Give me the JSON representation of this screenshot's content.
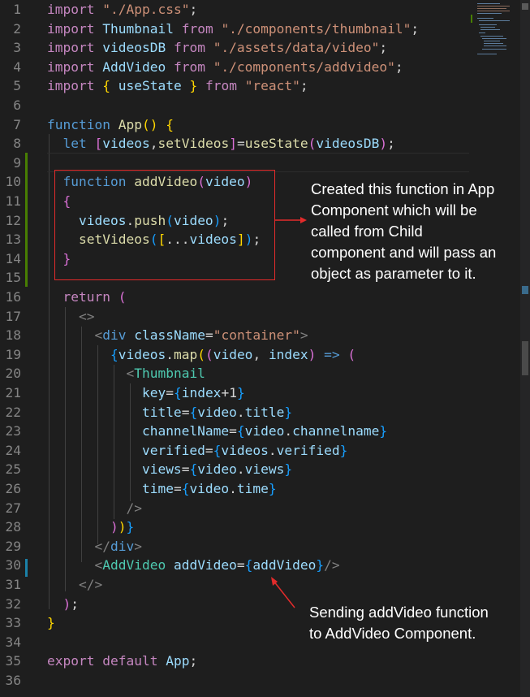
{
  "editor": {
    "lines": [
      {
        "n": "1",
        "tokens": [
          [
            "kw",
            "import"
          ],
          [
            "t",
            " "
          ],
          [
            "str",
            "\"./App.css\""
          ],
          [
            "t",
            ";"
          ]
        ]
      },
      {
        "n": "2",
        "tokens": [
          [
            "kw",
            "import"
          ],
          [
            "t",
            " "
          ],
          [
            "var",
            "Thumbnail"
          ],
          [
            "t",
            " "
          ],
          [
            "kw",
            "from"
          ],
          [
            "t",
            " "
          ],
          [
            "str",
            "\"./components/thumbnail\""
          ],
          [
            "t",
            ";"
          ]
        ]
      },
      {
        "n": "3",
        "tokens": [
          [
            "kw",
            "import"
          ],
          [
            "t",
            " "
          ],
          [
            "var",
            "videosDB"
          ],
          [
            "t",
            " "
          ],
          [
            "kw",
            "from"
          ],
          [
            "t",
            " "
          ],
          [
            "str",
            "\"./assets/data/video\""
          ],
          [
            "t",
            ";"
          ]
        ]
      },
      {
        "n": "4",
        "tokens": [
          [
            "kw",
            "import"
          ],
          [
            "t",
            " "
          ],
          [
            "var",
            "AddVideo"
          ],
          [
            "t",
            " "
          ],
          [
            "kw",
            "from"
          ],
          [
            "t",
            " "
          ],
          [
            "str",
            "\"./components/addvideo\""
          ],
          [
            "t",
            ";"
          ]
        ]
      },
      {
        "n": "5",
        "tokens": [
          [
            "kw",
            "import"
          ],
          [
            "t",
            " "
          ],
          [
            "b1",
            "{"
          ],
          [
            "t",
            " "
          ],
          [
            "var",
            "useState"
          ],
          [
            "t",
            " "
          ],
          [
            "b1",
            "}"
          ],
          [
            "t",
            " "
          ],
          [
            "kw",
            "from"
          ],
          [
            "t",
            " "
          ],
          [
            "str",
            "\"react\""
          ],
          [
            "t",
            ";"
          ]
        ]
      },
      {
        "n": "6",
        "tokens": []
      },
      {
        "n": "7",
        "tokens": [
          [
            "dkw",
            "function"
          ],
          [
            "t",
            " "
          ],
          [
            "fn",
            "App"
          ],
          [
            "b1",
            "()"
          ],
          [
            "t",
            " "
          ],
          [
            "b1",
            "{"
          ]
        ]
      },
      {
        "n": "8",
        "tokens": [
          [
            "t",
            "  "
          ],
          [
            "dkw",
            "let"
          ],
          [
            "t",
            " "
          ],
          [
            "b2",
            "["
          ],
          [
            "var",
            "videos"
          ],
          [
            "t",
            ","
          ],
          [
            "fn",
            "setVideos"
          ],
          [
            "b2",
            "]"
          ],
          [
            "t",
            "="
          ],
          [
            "fn",
            "useState"
          ],
          [
            "b2",
            "("
          ],
          [
            "var",
            "videosDB"
          ],
          [
            "b2",
            ")"
          ],
          [
            "t",
            ";"
          ]
        ]
      },
      {
        "n": "9",
        "tokens": []
      },
      {
        "n": "10",
        "tokens": [
          [
            "t",
            "  "
          ],
          [
            "dkw",
            "function"
          ],
          [
            "t",
            " "
          ],
          [
            "fn",
            "addVideo"
          ],
          [
            "b2",
            "("
          ],
          [
            "var",
            "video"
          ],
          [
            "b2",
            ")"
          ]
        ]
      },
      {
        "n": "11",
        "tokens": [
          [
            "t",
            "  "
          ],
          [
            "b2",
            "{"
          ]
        ]
      },
      {
        "n": "12",
        "tokens": [
          [
            "t",
            "    "
          ],
          [
            "var",
            "videos"
          ],
          [
            "t",
            "."
          ],
          [
            "fn",
            "push"
          ],
          [
            "b3",
            "("
          ],
          [
            "var",
            "video"
          ],
          [
            "b3",
            ")"
          ],
          [
            "t",
            ";"
          ]
        ]
      },
      {
        "n": "13",
        "tokens": [
          [
            "t",
            "    "
          ],
          [
            "fn",
            "setVideos"
          ],
          [
            "b3",
            "("
          ],
          [
            "b1",
            "["
          ],
          [
            "t",
            "..."
          ],
          [
            "var",
            "videos"
          ],
          [
            "b1",
            "]"
          ],
          [
            "b3",
            ")"
          ],
          [
            "t",
            ";"
          ]
        ]
      },
      {
        "n": "14",
        "tokens": [
          [
            "t",
            "  "
          ],
          [
            "b2",
            "}"
          ]
        ]
      },
      {
        "n": "15",
        "tokens": []
      },
      {
        "n": "16",
        "tokens": [
          [
            "t",
            "  "
          ],
          [
            "kw",
            "return"
          ],
          [
            "t",
            " "
          ],
          [
            "b2",
            "("
          ]
        ]
      },
      {
        "n": "17",
        "tokens": [
          [
            "t",
            "    "
          ],
          [
            "pun",
            "<>"
          ]
        ]
      },
      {
        "n": "18",
        "tokens": [
          [
            "t",
            "      "
          ],
          [
            "pun",
            "<"
          ],
          [
            "tag",
            "div"
          ],
          [
            "t",
            " "
          ],
          [
            "attr",
            "className"
          ],
          [
            "t",
            "="
          ],
          [
            "str",
            "\"container\""
          ],
          [
            "pun",
            ">"
          ]
        ]
      },
      {
        "n": "19",
        "tokens": [
          [
            "t",
            "        "
          ],
          [
            "b3",
            "{"
          ],
          [
            "var",
            "videos"
          ],
          [
            "t",
            "."
          ],
          [
            "fn",
            "map"
          ],
          [
            "b1",
            "("
          ],
          [
            "b2",
            "("
          ],
          [
            "var",
            "video"
          ],
          [
            "t",
            ", "
          ],
          [
            "var",
            "index"
          ],
          [
            "b2",
            ")"
          ],
          [
            "t",
            " "
          ],
          [
            "dkw",
            "=>"
          ],
          [
            "t",
            " "
          ],
          [
            "b2",
            "("
          ]
        ]
      },
      {
        "n": "20",
        "tokens": [
          [
            "t",
            "          "
          ],
          [
            "pun",
            "<"
          ],
          [
            "comp",
            "Thumbnail"
          ]
        ]
      },
      {
        "n": "21",
        "tokens": [
          [
            "t",
            "            "
          ],
          [
            "attr",
            "key"
          ],
          [
            "t",
            "="
          ],
          [
            "b3",
            "{"
          ],
          [
            "var",
            "index"
          ],
          [
            "t",
            "+"
          ],
          [
            "t",
            "1"
          ],
          [
            "b3",
            "}"
          ]
        ]
      },
      {
        "n": "22",
        "tokens": [
          [
            "t",
            "            "
          ],
          [
            "attr",
            "title"
          ],
          [
            "t",
            "="
          ],
          [
            "b3",
            "{"
          ],
          [
            "var",
            "video"
          ],
          [
            "t",
            "."
          ],
          [
            "var",
            "title"
          ],
          [
            "b3",
            "}"
          ]
        ]
      },
      {
        "n": "23",
        "tokens": [
          [
            "t",
            "            "
          ],
          [
            "attr",
            "channelName"
          ],
          [
            "t",
            "="
          ],
          [
            "b3",
            "{"
          ],
          [
            "var",
            "video"
          ],
          [
            "t",
            "."
          ],
          [
            "var",
            "channelname"
          ],
          [
            "b3",
            "}"
          ]
        ]
      },
      {
        "n": "24",
        "tokens": [
          [
            "t",
            "            "
          ],
          [
            "attr",
            "verified"
          ],
          [
            "t",
            "="
          ],
          [
            "b3",
            "{"
          ],
          [
            "var",
            "videos"
          ],
          [
            "t",
            "."
          ],
          [
            "var",
            "verified"
          ],
          [
            "b3",
            "}"
          ]
        ]
      },
      {
        "n": "25",
        "tokens": [
          [
            "t",
            "            "
          ],
          [
            "attr",
            "views"
          ],
          [
            "t",
            "="
          ],
          [
            "b3",
            "{"
          ],
          [
            "var",
            "video"
          ],
          [
            "t",
            "."
          ],
          [
            "var",
            "views"
          ],
          [
            "b3",
            "}"
          ]
        ]
      },
      {
        "n": "26",
        "tokens": [
          [
            "t",
            "            "
          ],
          [
            "attr",
            "time"
          ],
          [
            "t",
            "="
          ],
          [
            "b3",
            "{"
          ],
          [
            "var",
            "video"
          ],
          [
            "t",
            "."
          ],
          [
            "var",
            "time"
          ],
          [
            "b3",
            "}"
          ]
        ]
      },
      {
        "n": "27",
        "tokens": [
          [
            "t",
            "          "
          ],
          [
            "pun",
            "/>"
          ]
        ]
      },
      {
        "n": "28",
        "tokens": [
          [
            "t",
            "        "
          ],
          [
            "b2",
            ")"
          ],
          [
            "b1",
            ")"
          ],
          [
            "b3",
            "}"
          ]
        ]
      },
      {
        "n": "29",
        "tokens": [
          [
            "t",
            "      "
          ],
          [
            "pun",
            "</"
          ],
          [
            "tag",
            "div"
          ],
          [
            "pun",
            ">"
          ]
        ]
      },
      {
        "n": "30",
        "tokens": [
          [
            "t",
            "      "
          ],
          [
            "pun",
            "<"
          ],
          [
            "comp",
            "AddVideo"
          ],
          [
            "t",
            " "
          ],
          [
            "attr",
            "addVideo"
          ],
          [
            "t",
            "="
          ],
          [
            "b3",
            "{"
          ],
          [
            "var",
            "addVideo"
          ],
          [
            "b3",
            "}"
          ],
          [
            "pun",
            "/>"
          ]
        ]
      },
      {
        "n": "31",
        "tokens": [
          [
            "t",
            "    "
          ],
          [
            "pun",
            "</>"
          ]
        ]
      },
      {
        "n": "32",
        "tokens": [
          [
            "t",
            "  "
          ],
          [
            "b2",
            ")"
          ],
          [
            "t",
            ";"
          ]
        ]
      },
      {
        "n": "33",
        "tokens": [
          [
            "b1",
            "}"
          ]
        ]
      },
      {
        "n": "34",
        "tokens": []
      },
      {
        "n": "35",
        "tokens": [
          [
            "kw",
            "export"
          ],
          [
            "t",
            " "
          ],
          [
            "kw",
            "default"
          ],
          [
            "t",
            " "
          ],
          [
            "var",
            "App"
          ],
          [
            "t",
            ";"
          ]
        ]
      },
      {
        "n": "36",
        "tokens": []
      }
    ]
  },
  "annotations": {
    "note1": [
      "Created this function in App",
      "Component which will be",
      "called from Child",
      "component and will pass an",
      "object as parameter to it."
    ],
    "note2": [
      "Sending addVideo function",
      "to AddVideo Component."
    ]
  },
  "colors": {
    "background": "#1e1e1e",
    "annotation_red": "#e32b2b",
    "keyword": "#c586c0",
    "declaration": "#569cd6",
    "function": "#dcdcaa",
    "variable": "#9cdcfe",
    "string": "#ce9178",
    "component": "#4ec9b0"
  }
}
